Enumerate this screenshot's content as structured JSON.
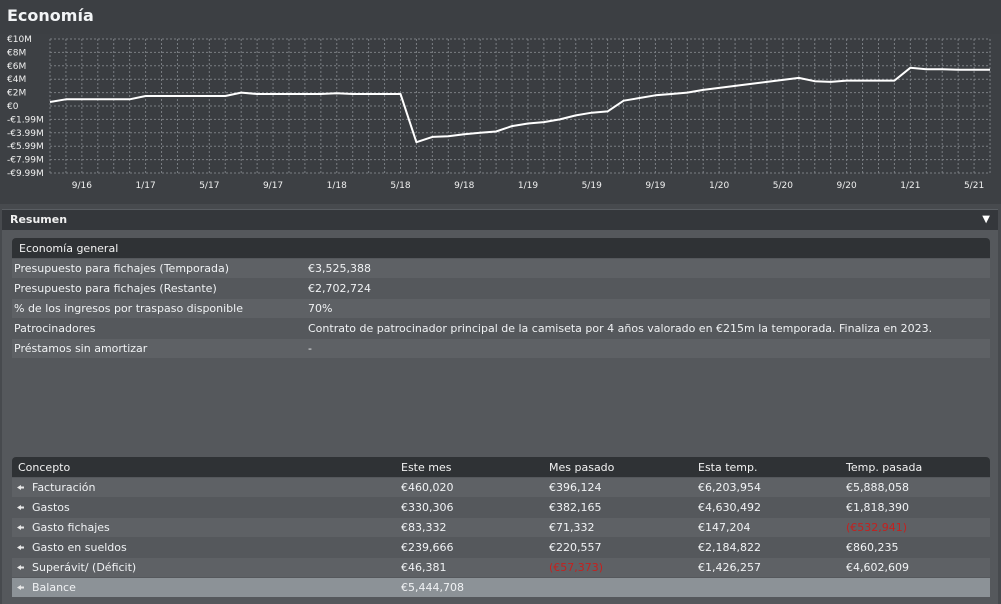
{
  "page_title": "Economía",
  "chart_data": {
    "type": "line",
    "y_ticks": [
      "€10M",
      "€8M",
      "€6M",
      "€4M",
      "€2M",
      "€0",
      "-€1.99M",
      "-€3.99M",
      "-€5.99M",
      "-€7.99M",
      "-€9.99M"
    ],
    "x_ticks": [
      "9/16",
      "1/17",
      "5/17",
      "9/17",
      "1/18",
      "5/18",
      "9/18",
      "1/19",
      "5/19",
      "9/19",
      "1/20",
      "5/20",
      "9/20",
      "1/21",
      "5/21"
    ],
    "ylim": [
      -9.99,
      10
    ],
    "grid": true,
    "series": [
      {
        "color": "#ffffff",
        "x": [
          "7/16",
          "8/16",
          "9/16",
          "10/16",
          "11/16",
          "12/16",
          "1/17",
          "2/17",
          "3/17",
          "4/17",
          "5/17",
          "6/17",
          "7/17",
          "8/17",
          "9/17",
          "10/17",
          "11/17",
          "12/17",
          "1/18",
          "2/18",
          "3/18",
          "4/18",
          "5/18",
          "6/18",
          "7/18",
          "8/18",
          "9/18",
          "10/18",
          "11/18",
          "12/18",
          "1/19",
          "2/19",
          "3/19",
          "4/19",
          "5/19",
          "6/19",
          "7/19",
          "8/19",
          "9/19",
          "10/19",
          "11/19",
          "12/19",
          "1/20",
          "2/20",
          "3/20",
          "4/20",
          "5/20",
          "6/20",
          "7/20",
          "8/20",
          "9/20",
          "10/20",
          "11/20",
          "12/20",
          "1/21",
          "2/21",
          "3/21",
          "4/21",
          "5/21",
          "6/21"
        ],
        "y": [
          0.6,
          1.0,
          1.0,
          1.0,
          1.0,
          1.0,
          1.5,
          1.5,
          1.5,
          1.5,
          1.5,
          1.5,
          2.0,
          1.8,
          1.8,
          1.8,
          1.8,
          1.8,
          1.9,
          1.8,
          1.8,
          1.8,
          1.8,
          -5.4,
          -4.6,
          -4.5,
          -4.2,
          -4.0,
          -3.8,
          -3.0,
          -2.6,
          -2.4,
          -2.0,
          -1.4,
          -1.0,
          -0.8,
          0.8,
          1.2,
          1.6,
          1.8,
          2.0,
          2.4,
          2.7,
          3.0,
          3.3,
          3.6,
          3.9,
          4.2,
          3.7,
          3.6,
          3.8,
          3.8,
          3.8,
          3.8,
          5.7,
          5.5,
          5.5,
          5.4,
          5.4,
          5.4
        ]
      }
    ]
  },
  "resumen": {
    "label": "Resumen"
  },
  "economia_general": {
    "header": "Economía general",
    "rows": [
      {
        "label": "Presupuesto para fichajes (Temporada)",
        "value": "€3,525,388"
      },
      {
        "label": "Presupuesto para fichajes (Restante)",
        "value": "€2,702,724"
      },
      {
        "label": "% de los ingresos por traspaso disponible",
        "value": "70%"
      },
      {
        "label": "Patrocinadores",
        "value": "Contrato de patrocinador principal de la camiseta por 4 años valorado en €215m la temporada. Finaliza en 2023."
      },
      {
        "label": "Préstamos sin amortizar",
        "value": "-"
      }
    ]
  },
  "table": {
    "headers": [
      "Concepto",
      "Este mes",
      "Mes pasado",
      "Esta temp.",
      "Temp. pasada"
    ],
    "rows": [
      {
        "cells": [
          "Facturación",
          "€460,020",
          "€396,124",
          "€6,203,954",
          "€5,888,058"
        ]
      },
      {
        "cells": [
          "Gastos",
          "€330,306",
          "€382,165",
          "€4,630,492",
          "€1,818,390"
        ]
      },
      {
        "cells": [
          "Gasto fichajes",
          "€83,332",
          "€71,332",
          "€147,204",
          "(€532,941)"
        ]
      },
      {
        "cells": [
          "Gasto en sueldos",
          "€239,666",
          "€220,557",
          "€2,184,822",
          "€860,235"
        ]
      },
      {
        "cells": [
          "Superávit/ (Déficit)",
          "€46,381",
          "(€57,373)",
          "€1,426,257",
          "€4,602,609"
        ]
      },
      {
        "cells": [
          "Balance",
          "€5,444,708",
          "",
          "",
          ""
        ]
      }
    ]
  },
  "colors": {
    "negative": "#c4211f",
    "line": "#ffffff",
    "highlight_row": "#8c9297"
  }
}
